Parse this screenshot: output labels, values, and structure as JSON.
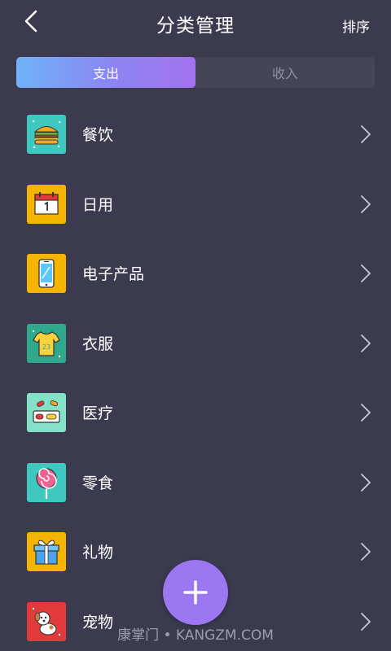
{
  "header": {
    "title": "分类管理",
    "sort_label": "排序"
  },
  "tabs": [
    {
      "label": "支出",
      "active": true
    },
    {
      "label": "收入",
      "active": false
    }
  ],
  "categories": [
    {
      "label": "餐饮",
      "icon": "burger-icon",
      "color": "#3ec8c0"
    },
    {
      "label": "日用",
      "icon": "calendar-icon",
      "color": "#f5b400"
    },
    {
      "label": "电子产品",
      "icon": "phone-icon",
      "color": "#f5b400"
    },
    {
      "label": "衣服",
      "icon": "shirt-icon",
      "color": "#2fa88c"
    },
    {
      "label": "医疗",
      "icon": "pills-icon",
      "color": "#84e0c6"
    },
    {
      "label": "零食",
      "icon": "lollipop-icon",
      "color": "#3ec8c0"
    },
    {
      "label": "礼物",
      "icon": "gift-icon",
      "color": "#f5b400"
    },
    {
      "label": "宠物",
      "icon": "dog-icon",
      "color": "#e23a3a"
    }
  ],
  "fab": {
    "icon": "plus-icon",
    "color": "#9b77f1"
  },
  "watermark": "康掌门 • KANGZM.COM",
  "colors": {
    "background": "#3b3a4e",
    "segment_bg": "#45455a",
    "accent_gradient_start": "#6fb3f7",
    "accent_gradient_end": "#a372f0"
  }
}
